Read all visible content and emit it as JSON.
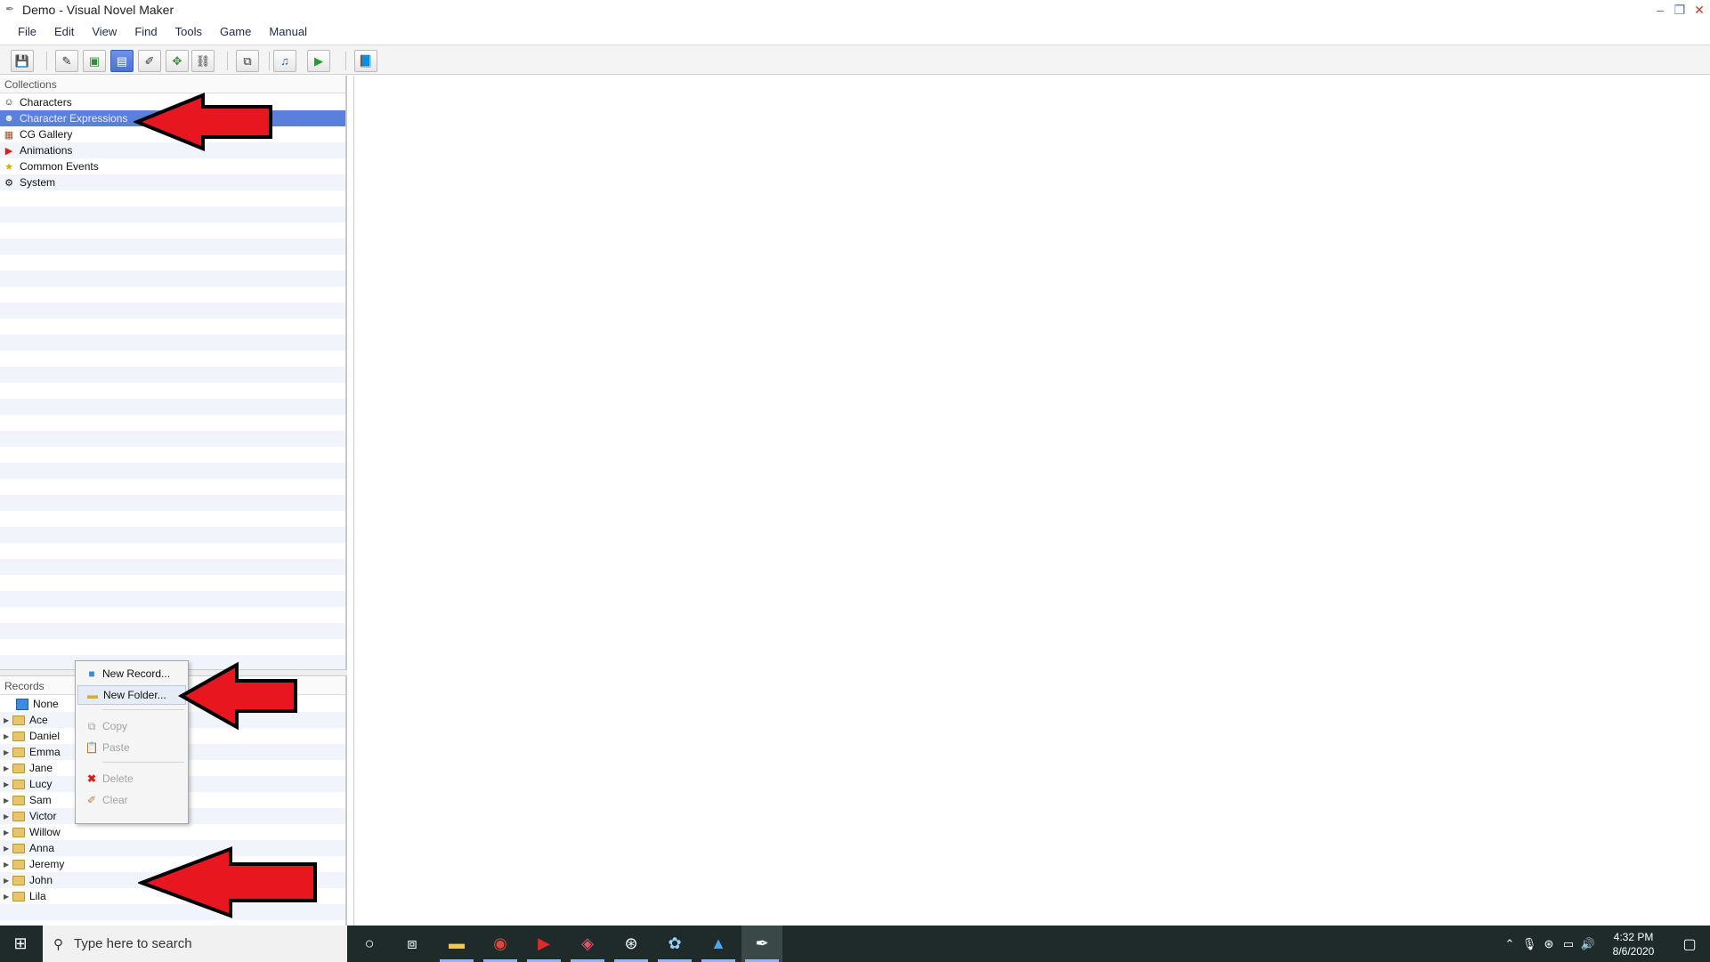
{
  "window": {
    "title": "Demo - Visual Novel Maker"
  },
  "menu": [
    "File",
    "Edit",
    "View",
    "Find",
    "Tools",
    "Game",
    "Manual"
  ],
  "toolbar": {
    "buttons": [
      "save",
      "script-editor",
      "scene-editor",
      "database",
      "layout",
      "materials",
      "plugins",
      "copy",
      "music",
      "play",
      "help"
    ],
    "active": "database"
  },
  "collections": {
    "header": "Collections",
    "items": [
      {
        "label": "Characters",
        "icon": "character-icon",
        "selected": false
      },
      {
        "label": "Character Expressions",
        "icon": "expression-icon",
        "selected": true
      },
      {
        "label": "CG Gallery",
        "icon": "gallery-icon",
        "selected": false
      },
      {
        "label": "Animations",
        "icon": "animation-icon",
        "selected": false
      },
      {
        "label": "Common Events",
        "icon": "star-icon",
        "selected": false
      },
      {
        "label": "System",
        "icon": "gear-icon",
        "selected": false
      }
    ]
  },
  "records": {
    "header": "Records",
    "items": [
      {
        "label": "None",
        "type": "record"
      },
      {
        "label": "Ace",
        "type": "folder"
      },
      {
        "label": "Daniel",
        "type": "folder"
      },
      {
        "label": "Emma",
        "type": "folder"
      },
      {
        "label": "Jane",
        "type": "folder"
      },
      {
        "label": "Lucy",
        "type": "folder"
      },
      {
        "label": "Sam",
        "type": "folder"
      },
      {
        "label": "Victor",
        "type": "folder"
      },
      {
        "label": "Willow",
        "type": "folder"
      },
      {
        "label": "Anna",
        "type": "folder"
      },
      {
        "label": "Jeremy",
        "type": "folder"
      },
      {
        "label": "John",
        "type": "folder"
      },
      {
        "label": "Lila",
        "type": "folder"
      }
    ]
  },
  "context_menu": {
    "items": [
      {
        "label": "New Record...",
        "enabled": true,
        "hovered": false
      },
      {
        "label": "New Folder...",
        "enabled": true,
        "hovered": true
      },
      {
        "label": "Copy",
        "enabled": false
      },
      {
        "label": "Paste",
        "enabled": false
      },
      {
        "label": "Delete",
        "enabled": false
      },
      {
        "label": "Clear",
        "enabled": false
      }
    ]
  },
  "taskbar": {
    "search_placeholder": "Type here to search",
    "time": "4:32 PM",
    "date": "8/6/2020"
  },
  "colors": {
    "selection": "#5a7fdc",
    "annotation_arrow": "#e8161f",
    "taskbar": "#1f2b2b"
  }
}
